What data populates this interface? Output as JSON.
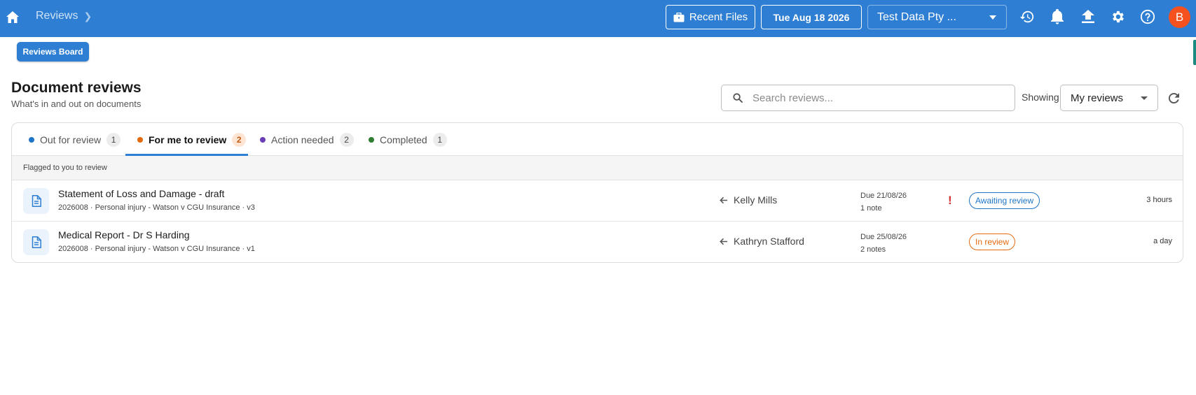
{
  "topbar": {
    "breadcrumb": "Reviews",
    "recent_files_label": "Recent Files",
    "date_label": "Tue Aug 18 2026",
    "company_label": "Test Data Pty ...",
    "avatar_initial": "B",
    "colors": {
      "bar": "#2e7fd3",
      "avatar": "#f4511e"
    }
  },
  "board_button_label": "Reviews Board",
  "page": {
    "title": "Document reviews",
    "subtitle": "What's in and out on documents"
  },
  "search": {
    "placeholder": "Search reviews..."
  },
  "filter": {
    "label": "Showing",
    "selected": "My reviews"
  },
  "tabs": [
    {
      "label": "Out for review",
      "count": "1",
      "color": "#1e74c7"
    },
    {
      "label": "For me to review",
      "count": "2",
      "color": "#e46a10"
    },
    {
      "label": "Action needed",
      "count": "2",
      "color": "#6a3fb5"
    },
    {
      "label": "Completed",
      "count": "1",
      "color": "#2e7d32"
    }
  ],
  "section_header": "Flagged to you to review",
  "rows": [
    {
      "title": "Statement of Loss and Damage - draft",
      "meta": "2026008 · Personal injury - Watson v CGU Insurance · v3",
      "from": "Kelly Mills",
      "due": "Due 21/08/26",
      "notes": "1 note",
      "urgent": "!",
      "status": "Awaiting review",
      "age": "3 hours"
    },
    {
      "title": "Medical Report - Dr S Harding",
      "meta": "2026008 · Personal injury - Watson v CGU Insurance · v1",
      "from": "Kathryn Stafford",
      "due": "Due 25/08/26",
      "notes": "2 notes",
      "urgent": "",
      "status": "In review",
      "age": "a day"
    }
  ]
}
